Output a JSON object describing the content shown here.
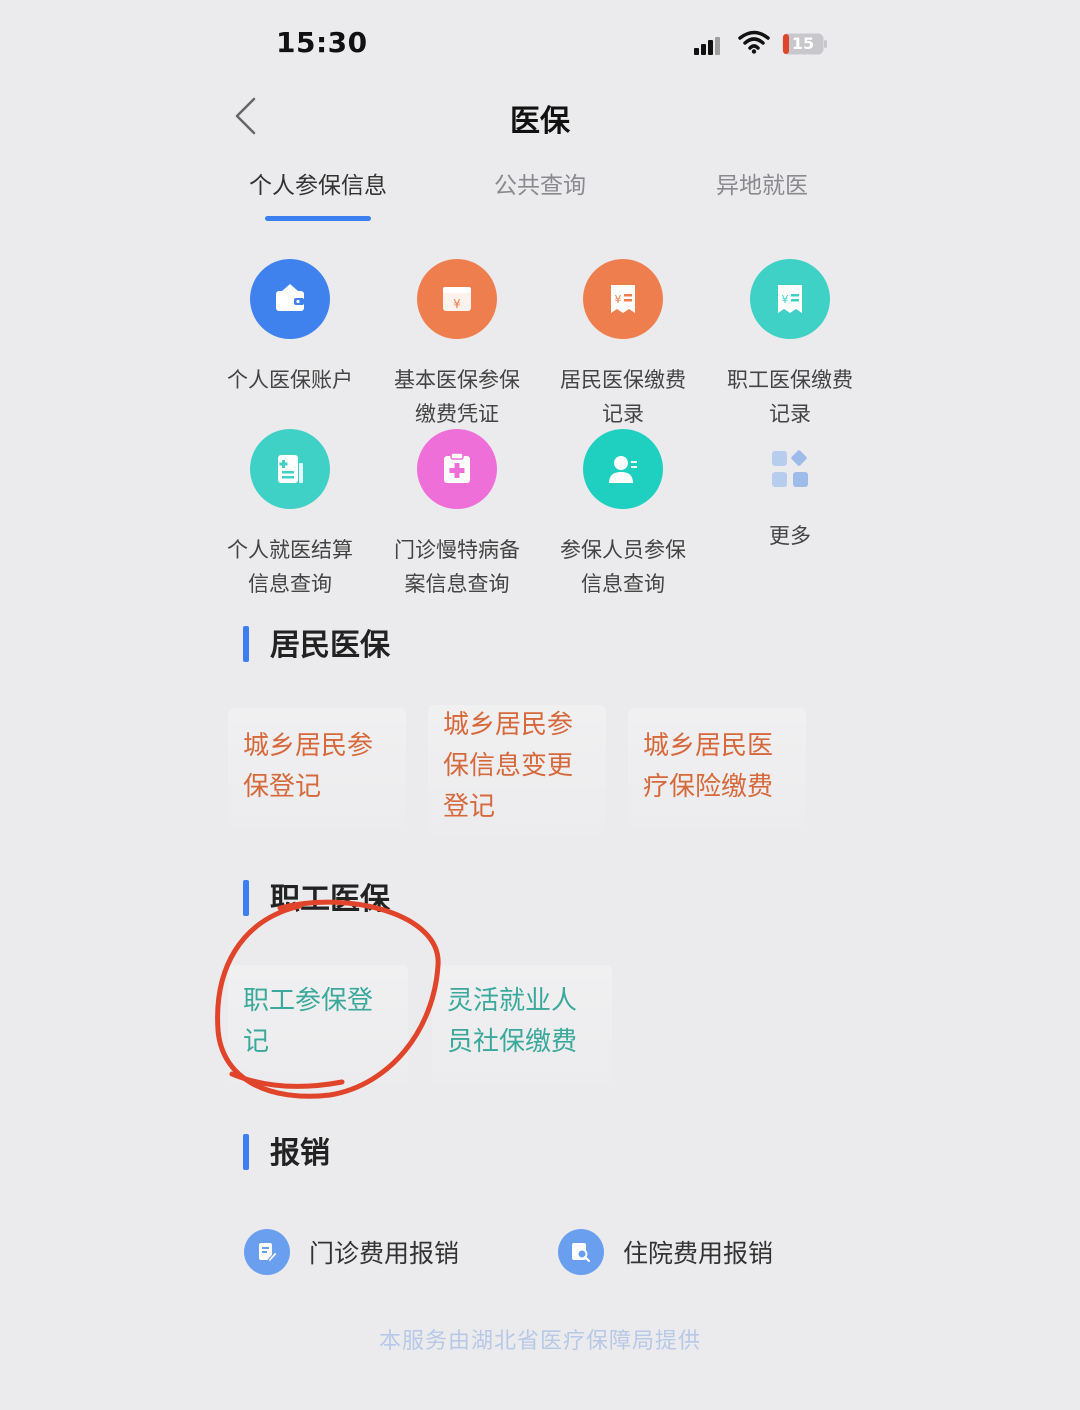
{
  "status_bar": {
    "time": "15:30",
    "battery_level": "15"
  },
  "nav": {
    "title": "医保",
    "back_icon": "chevron-left-icon"
  },
  "tabs": [
    {
      "label": "个人参保信息",
      "active": true
    },
    {
      "label": "公共查询",
      "active": false
    },
    {
      "label": "异地就医",
      "active": false
    }
  ],
  "grid": [
    {
      "label": "个人医保账户",
      "icon": "wallet-icon",
      "color": "#3f82ee"
    },
    {
      "label": "基本医保参保\n缴费凭证",
      "icon": "receipt-yuan-icon",
      "color": "#ef7e4e"
    },
    {
      "label": "居民医保缴费\n记录",
      "icon": "payment-record-icon",
      "color": "#ef7e4e"
    },
    {
      "label": "职工医保缴费\n记录",
      "icon": "payment-record-icon",
      "color": "#3fd0c6"
    },
    {
      "label": "个人就医结算\n信息查询",
      "icon": "document-icon",
      "color": "#3fd0c6"
    },
    {
      "label": "门诊慢特病备\n案信息查询",
      "icon": "medical-clipboard-icon",
      "color": "#ee6fd8"
    },
    {
      "label": "参保人员参保\n信息查询",
      "icon": "person-icon",
      "color": "#1fcfc0"
    },
    {
      "label": "更多",
      "icon": "grid-more-icon",
      "color": "#a9c4ee"
    }
  ],
  "sections": {
    "resident": {
      "title": "居民医保",
      "items": [
        "城乡居民参\n保登记",
        "城乡居民参\n保信息变更\n登记",
        "城乡居民医\n疗保险缴费"
      ]
    },
    "employee": {
      "title": "职工医保",
      "items": [
        "职工参保登\n记",
        "灵活就业人\n员社保缴费"
      ]
    },
    "reimbursement": {
      "title": "报销",
      "items": [
        {
          "label": "门诊费用报销",
          "icon": "pen-document-icon"
        },
        {
          "label": "住院费用报销",
          "icon": "search-document-icon"
        }
      ]
    }
  },
  "footer": "本服务由湖北省医疗保障局提供",
  "colors": {
    "accent": "#3b7ff1",
    "orange_text": "#d6693b",
    "green_text": "#3aa89a",
    "annotation_red": "#e0442a"
  }
}
